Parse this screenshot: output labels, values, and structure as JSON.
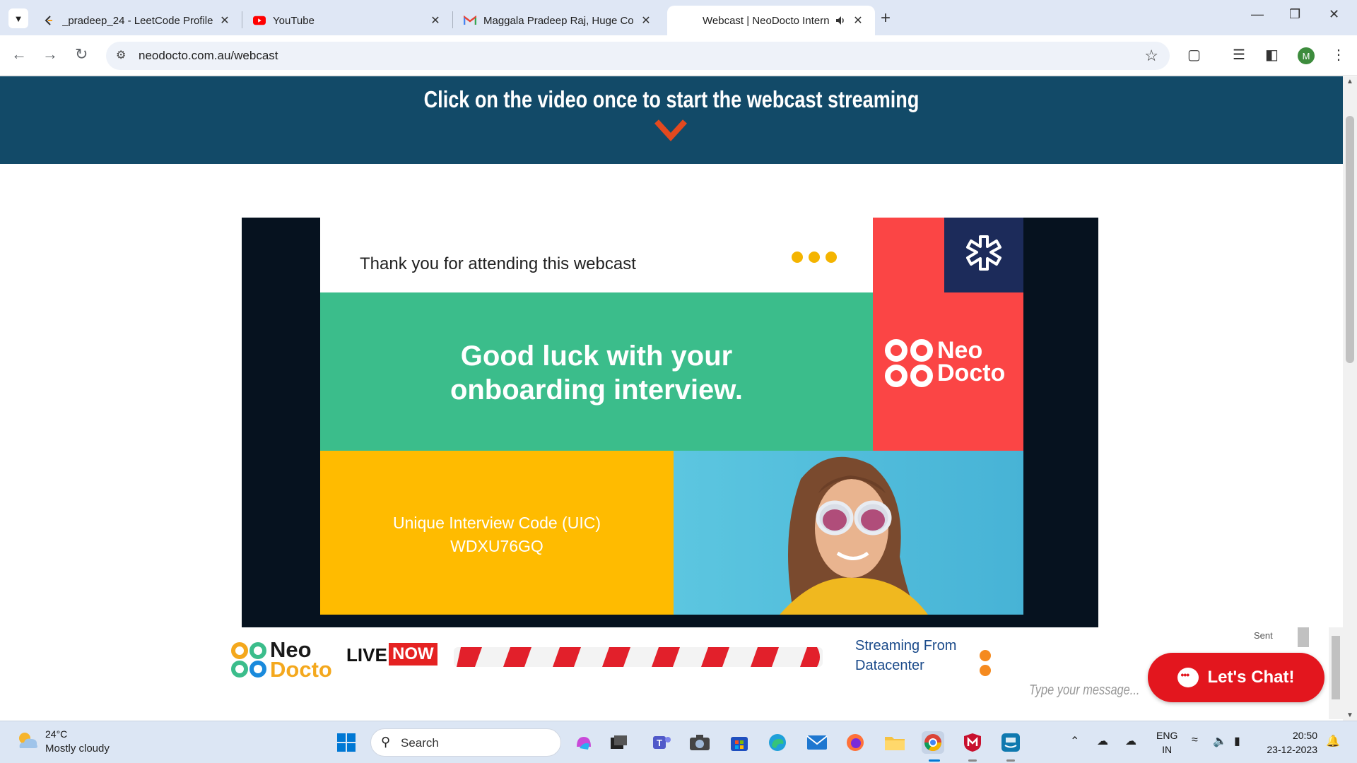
{
  "browser": {
    "tabs": [
      {
        "title": "_pradeep_24 - LeetCode Profile",
        "icon": "leetcode-icon"
      },
      {
        "title": "YouTube",
        "icon": "youtube-icon"
      },
      {
        "title": "Maggala Pradeep Raj, Huge Co",
        "icon": "gmail-icon"
      },
      {
        "title": "Webcast | NeoDocto Intern",
        "icon": "speaker-icon",
        "active": true
      }
    ],
    "url": "neodocto.com.au/webcast",
    "profile_initial": "M"
  },
  "page": {
    "banner_text": "Click on the video once to start the webcast streaming",
    "slide": {
      "thanks": "Thank you for attending this webcast",
      "message_line1": "Good luck with your",
      "message_line2": "onboarding interview.",
      "uic_label": "Unique Interview Code (UIC)",
      "uic_value": "WDXU76GQ",
      "logo_neo": "Neo",
      "logo_docto": "Docto"
    },
    "strip": {
      "logo_neo": "Neo",
      "logo_docto": "Docto",
      "live": "LIVE",
      "now": "NOW",
      "streaming_line1": "Streaming From",
      "streaming_line2": "Datacenter"
    },
    "chat": {
      "sent": "Sent",
      "placeholder": "Type your message...",
      "button": "Let's Chat!"
    }
  },
  "taskbar": {
    "temperature": "24°C",
    "condition": "Mostly cloudy",
    "search_label": "Search",
    "lang1": "ENG",
    "lang2": "IN",
    "time": "20:50",
    "date": "23-12-2023"
  },
  "colors": {
    "banner": "#124a68",
    "slide_green": "#3bbd8b",
    "slide_red": "#fb4545",
    "slide_yellow": "#ffbb00",
    "slide_navy": "#1c2b5a",
    "chat_red": "#e3161e"
  }
}
